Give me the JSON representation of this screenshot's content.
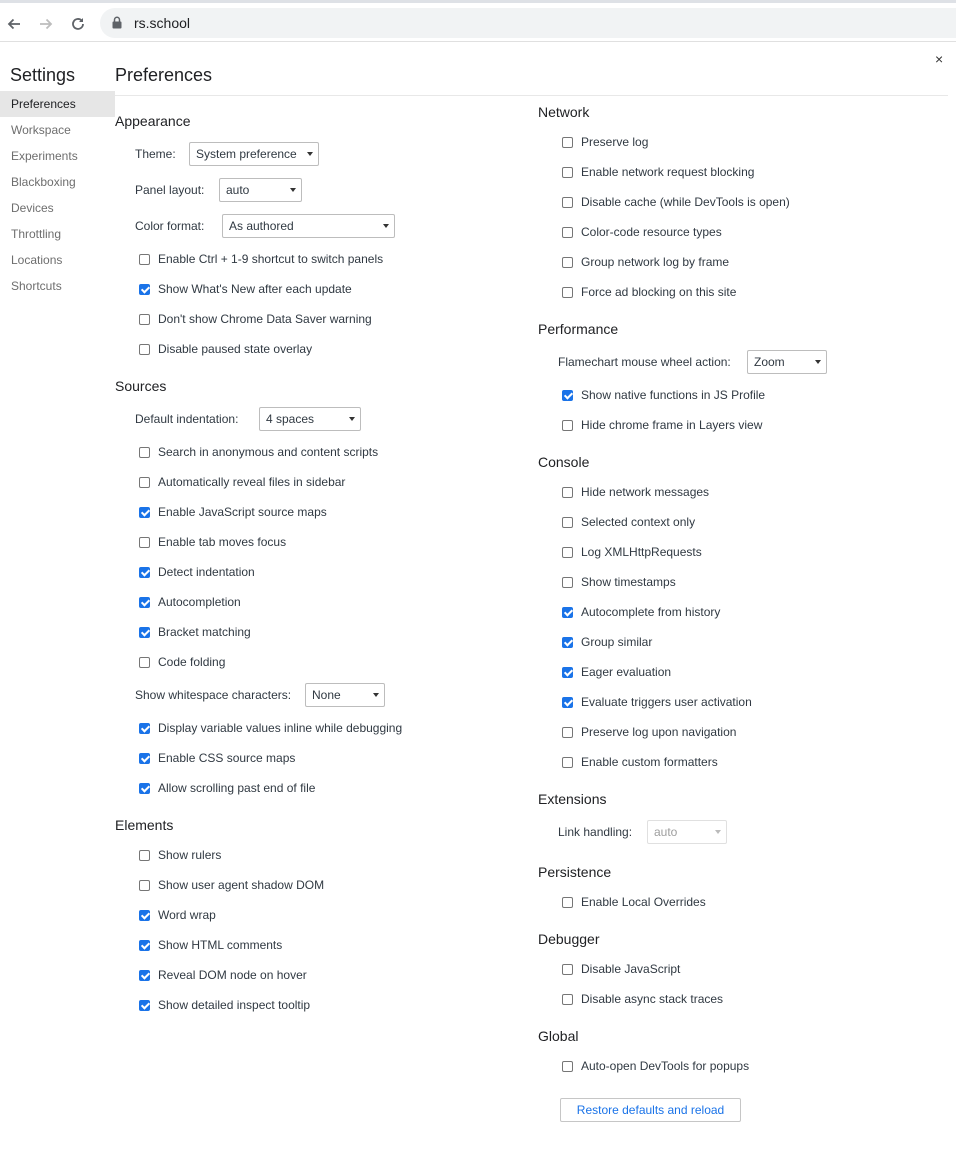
{
  "browser": {
    "url": "rs.school"
  },
  "sidebar": {
    "title": "Settings",
    "items": [
      {
        "label": "Preferences",
        "active": true
      },
      {
        "label": "Workspace"
      },
      {
        "label": "Experiments"
      },
      {
        "label": "Blackboxing"
      },
      {
        "label": "Devices"
      },
      {
        "label": "Throttling"
      },
      {
        "label": "Locations"
      },
      {
        "label": "Shortcuts"
      }
    ]
  },
  "page": {
    "title": "Preferences",
    "close": "×"
  },
  "appearance": {
    "title": "Appearance",
    "theme_label": "Theme:",
    "theme_value": "System preference",
    "panel_layout_label": "Panel layout:",
    "panel_layout_value": "auto",
    "color_format_label": "Color format:",
    "color_format_value": "As authored",
    "options": [
      {
        "label": "Enable Ctrl + 1-9 shortcut to switch panels",
        "checked": false
      },
      {
        "label": "Show What's New after each update",
        "checked": true
      },
      {
        "label": "Don't show Chrome Data Saver warning",
        "checked": false
      },
      {
        "label": "Disable paused state overlay",
        "checked": false
      }
    ]
  },
  "sources": {
    "title": "Sources",
    "indentation_label": "Default indentation:",
    "indentation_value": "4 spaces",
    "options": [
      {
        "label": "Search in anonymous and content scripts",
        "checked": false
      },
      {
        "label": "Automatically reveal files in sidebar",
        "checked": false
      },
      {
        "label": "Enable JavaScript source maps",
        "checked": true
      },
      {
        "label": "Enable tab moves focus",
        "checked": false
      },
      {
        "label": "Detect indentation",
        "checked": true
      },
      {
        "label": "Autocompletion",
        "checked": true
      },
      {
        "label": "Bracket matching",
        "checked": true
      },
      {
        "label": "Code folding",
        "checked": false
      }
    ],
    "whitespace_label": "Show whitespace characters:",
    "whitespace_value": "None",
    "options2": [
      {
        "label": "Display variable values inline while debugging",
        "checked": true
      },
      {
        "label": "Enable CSS source maps",
        "checked": true
      },
      {
        "label": "Allow scrolling past end of file",
        "checked": true
      }
    ]
  },
  "elements": {
    "title": "Elements",
    "options": [
      {
        "label": "Show rulers",
        "checked": false
      },
      {
        "label": "Show user agent shadow DOM",
        "checked": false
      },
      {
        "label": "Word wrap",
        "checked": true
      },
      {
        "label": "Show HTML comments",
        "checked": true
      },
      {
        "label": "Reveal DOM node on hover",
        "checked": true
      },
      {
        "label": "Show detailed inspect tooltip",
        "checked": true
      }
    ]
  },
  "network": {
    "title": "Network",
    "options": [
      {
        "label": "Preserve log",
        "checked": false
      },
      {
        "label": "Enable network request blocking",
        "checked": false
      },
      {
        "label": "Disable cache (while DevTools is open)",
        "checked": false
      },
      {
        "label": "Color-code resource types",
        "checked": false
      },
      {
        "label": "Group network log by frame",
        "checked": false
      },
      {
        "label": "Force ad blocking on this site",
        "checked": false
      }
    ]
  },
  "performance": {
    "title": "Performance",
    "flamechart_label": "Flamechart mouse wheel action:",
    "flamechart_value": "Zoom",
    "options": [
      {
        "label": "Show native functions in JS Profile",
        "checked": true
      },
      {
        "label": "Hide chrome frame in Layers view",
        "checked": false
      }
    ]
  },
  "console": {
    "title": "Console",
    "options": [
      {
        "label": "Hide network messages",
        "checked": false
      },
      {
        "label": "Selected context only",
        "checked": false
      },
      {
        "label": "Log XMLHttpRequests",
        "checked": false
      },
      {
        "label": "Show timestamps",
        "checked": false
      },
      {
        "label": "Autocomplete from history",
        "checked": true
      },
      {
        "label": "Group similar",
        "checked": true
      },
      {
        "label": "Eager evaluation",
        "checked": true
      },
      {
        "label": "Evaluate triggers user activation",
        "checked": true
      },
      {
        "label": "Preserve log upon navigation",
        "checked": false
      },
      {
        "label": "Enable custom formatters",
        "checked": false
      }
    ]
  },
  "extensions": {
    "title": "Extensions",
    "link_label": "Link handling:",
    "link_value": "auto"
  },
  "persistence": {
    "title": "Persistence",
    "options": [
      {
        "label": "Enable Local Overrides",
        "checked": false
      }
    ]
  },
  "debugger": {
    "title": "Debugger",
    "options": [
      {
        "label": "Disable JavaScript",
        "checked": false
      },
      {
        "label": "Disable async stack traces",
        "checked": false
      }
    ]
  },
  "global": {
    "title": "Global",
    "options": [
      {
        "label": "Auto-open DevTools for popups",
        "checked": false
      }
    ]
  },
  "restore_button": "Restore defaults and reload"
}
